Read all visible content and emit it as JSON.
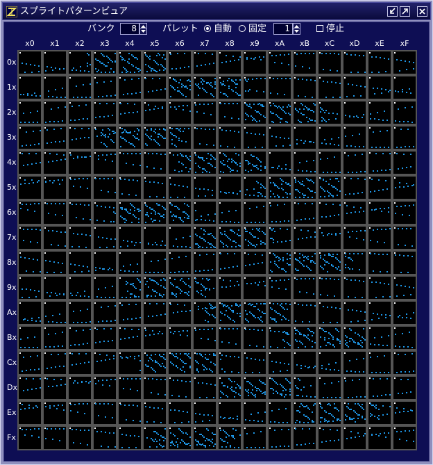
{
  "window": {
    "title": "スプライトパターンビュア",
    "app_icon": "sprite-app-icon",
    "buttons": [
      {
        "name": "minimize-icon"
      },
      {
        "name": "maximize-icon"
      },
      {
        "name": "close-icon"
      }
    ]
  },
  "controls": {
    "bank_label": "バンク",
    "bank_value": "8",
    "palette_label": "パレット",
    "radio_auto_label": "自動",
    "radio_fixed_label": "固定",
    "palette_value": "1",
    "stop_label": "停止",
    "selected_palette_mode": "auto",
    "stop_checked": false
  },
  "grid": {
    "col_headers": [
      "x0",
      "x1",
      "x2",
      "x3",
      "x4",
      "x5",
      "x6",
      "x7",
      "x8",
      "x9",
      "xA",
      "xB",
      "xC",
      "xD",
      "xE",
      "xF"
    ],
    "row_headers": [
      "0x",
      "1x",
      "2x",
      "3x",
      "4x",
      "5x",
      "6x",
      "7x",
      "8x",
      "9x",
      "Ax",
      "Bx",
      "Cx",
      "Dx",
      "Ex",
      "Fx"
    ],
    "cell_bg": "#000000",
    "border_color": "#555555",
    "pixel_color": "#1e96e6"
  }
}
